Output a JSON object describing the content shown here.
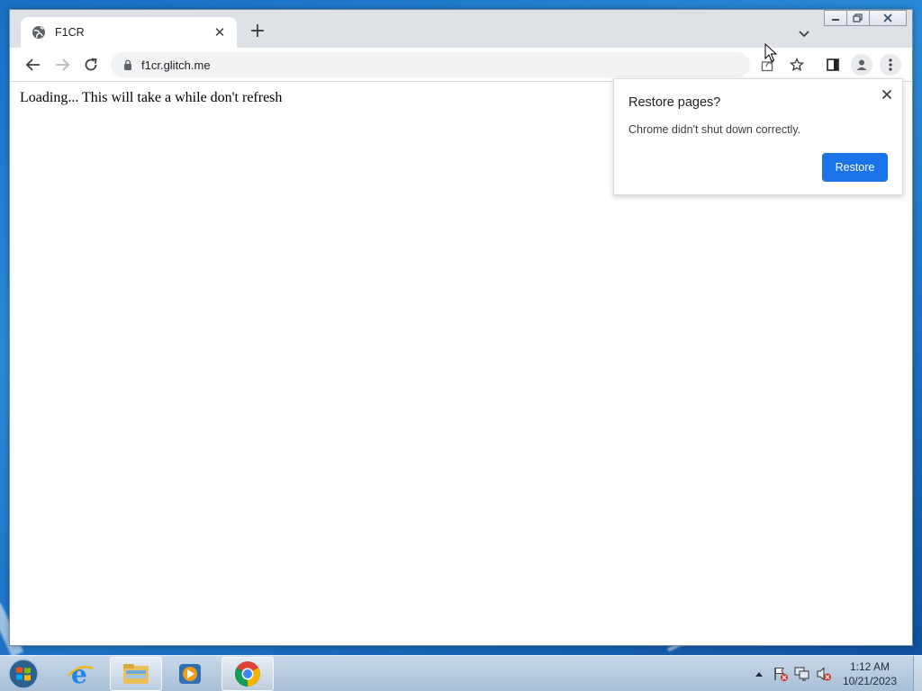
{
  "browser": {
    "tab": {
      "title": "F1CR"
    },
    "address_bar": {
      "url": "f1cr.glitch.me"
    }
  },
  "page": {
    "body_text": "Loading... This will take a while don't refresh"
  },
  "restore_bubble": {
    "title": "Restore pages?",
    "message": "Chrome didn't shut down correctly.",
    "button_label": "Restore"
  },
  "taskbar": {
    "apps": [
      "start-button",
      "internet-explorer",
      "windows-explorer",
      "windows-media-player",
      "google-chrome"
    ],
    "clock": {
      "time": "1:12 AM",
      "date": "10/21/2023"
    }
  },
  "colors": {
    "accent_blue": "#1a73e8",
    "tabstrip_bg": "#dee1e6",
    "omnibox_bg": "#f1f3f4"
  }
}
